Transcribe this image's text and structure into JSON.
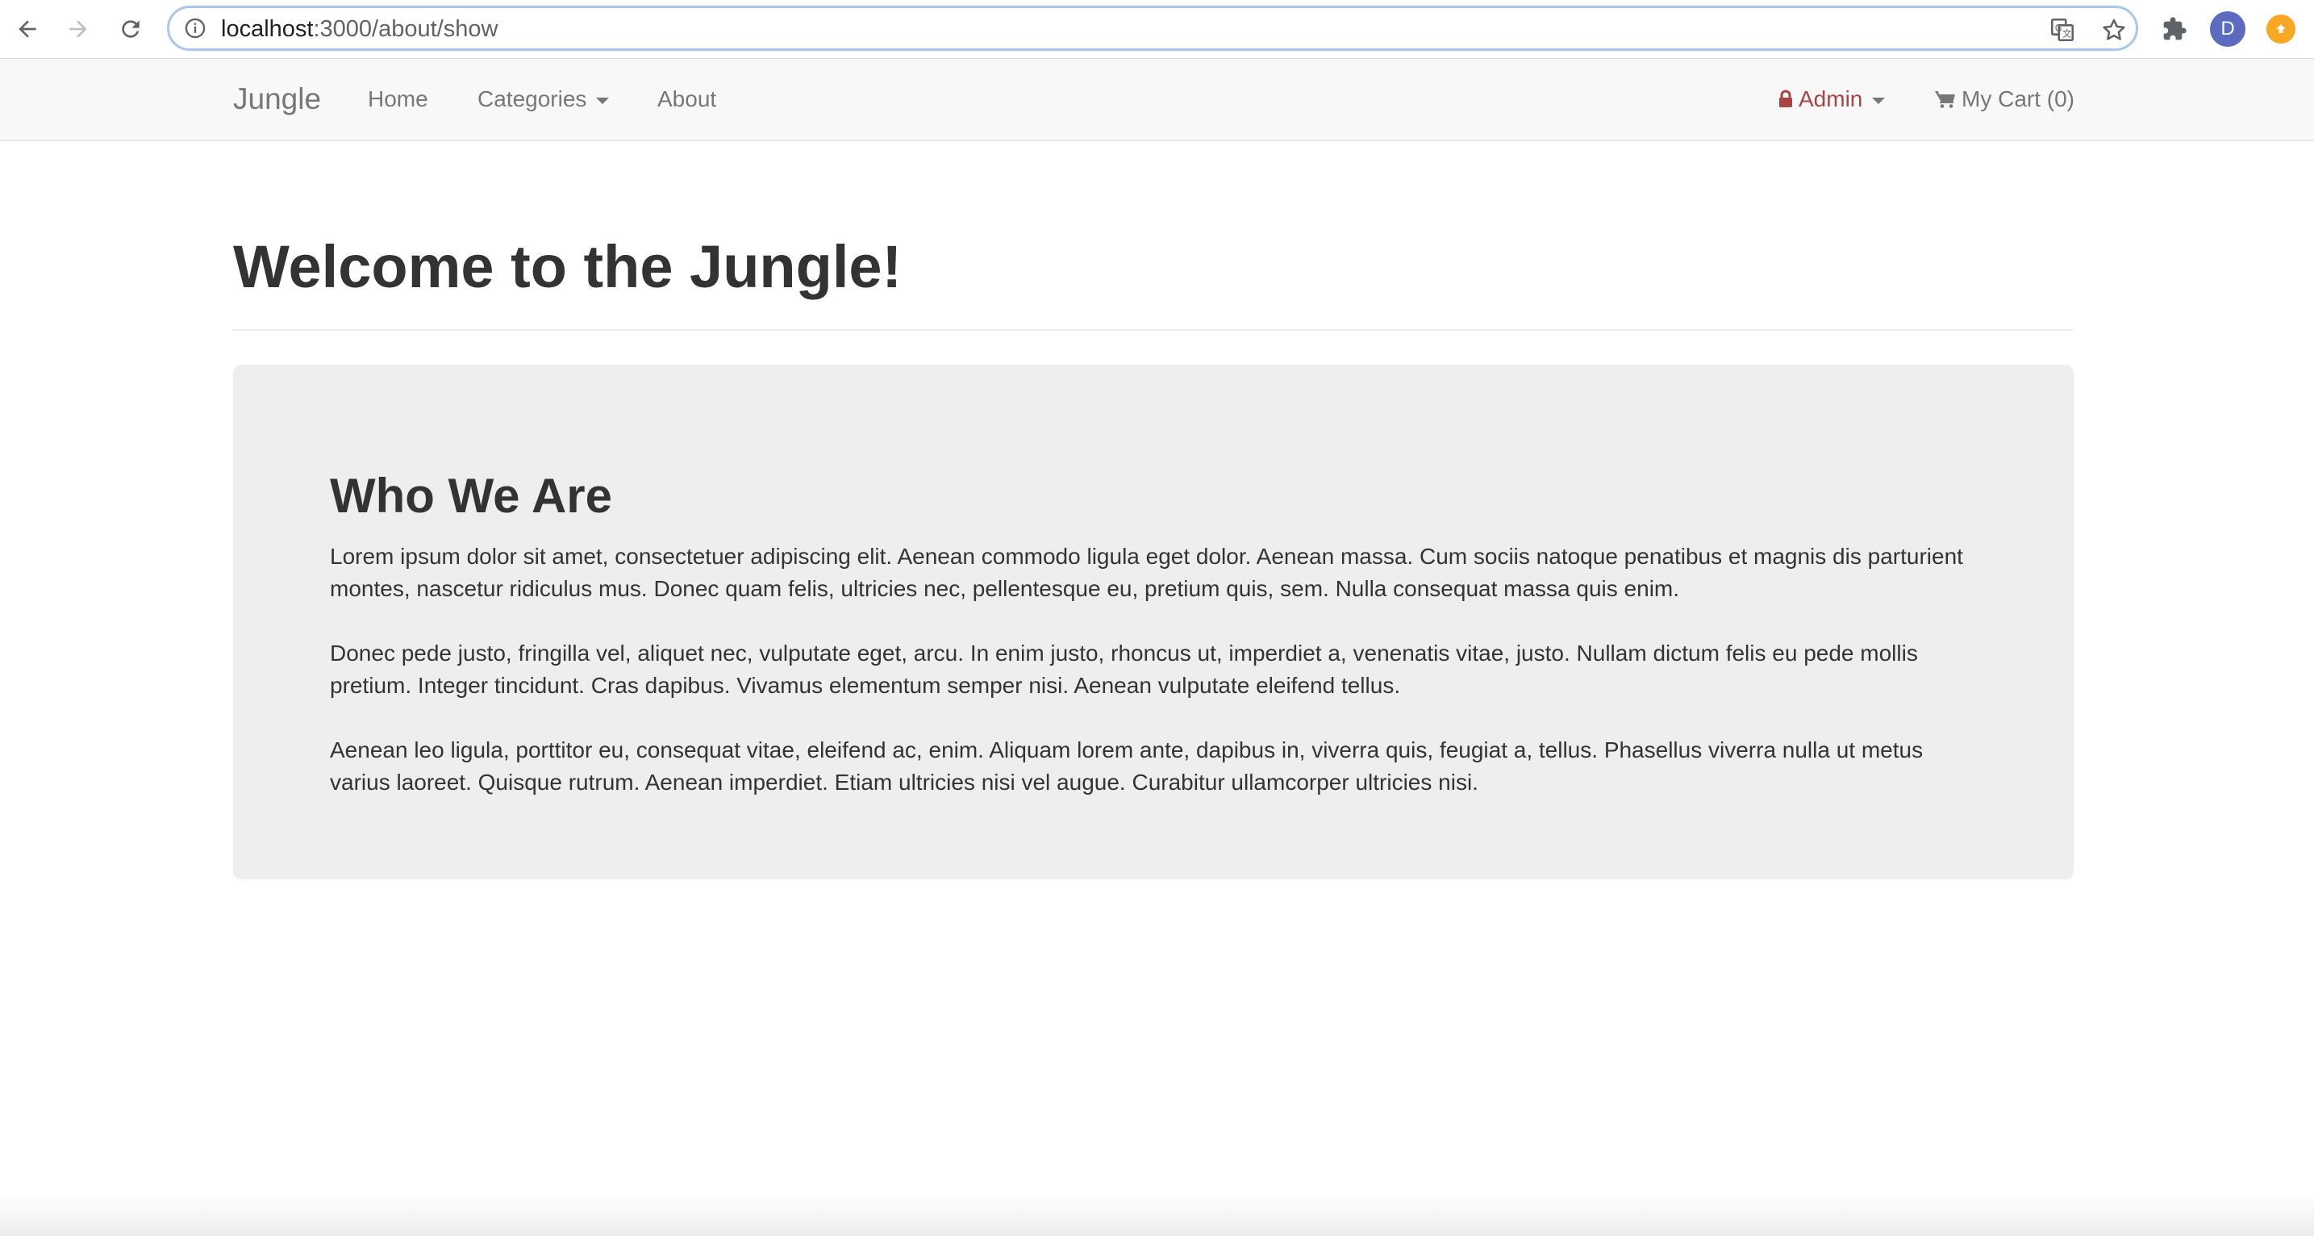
{
  "browser": {
    "url_host": "localhost",
    "url_path": ":3000/about/show",
    "profile_initial": "D"
  },
  "navbar": {
    "brand": "Jungle",
    "home": "Home",
    "categories": "Categories",
    "about": "About",
    "admin": "Admin",
    "cart": "My Cart (0)"
  },
  "page": {
    "title": "Welcome to the Jungle!",
    "section_heading": "Who We Are",
    "paragraphs": [
      "Lorem ipsum dolor sit amet, consectetuer adipiscing elit. Aenean commodo ligula eget dolor. Aenean massa. Cum sociis natoque penatibus et magnis dis parturient montes, nascetur ridiculus mus. Donec quam felis, ultricies nec, pellentesque eu, pretium quis, sem. Nulla consequat massa quis enim.",
      "Donec pede justo, fringilla vel, aliquet nec, vulputate eget, arcu. In enim justo, rhoncus ut, imperdiet a, venenatis vitae, justo. Nullam dictum felis eu pede mollis pretium. Integer tincidunt. Cras dapibus. Vivamus elementum semper nisi. Aenean vulputate eleifend tellus.",
      "Aenean leo ligula, porttitor eu, consequat vitae, eleifend ac, enim. Aliquam lorem ante, dapibus in, viverra quis, feugiat a, tellus. Phasellus viverra nulla ut metus varius laoreet. Quisque rutrum. Aenean imperdiet. Etiam ultricies nisi vel augue. Curabitur ullamcorper ultricies nisi."
    ]
  },
  "colors": {
    "admin_accent": "#a94442",
    "navbar_bg": "#f8f8f8",
    "jumbotron_bg": "#eeeeee",
    "text": "#333333",
    "nav_text": "#777777"
  },
  "icons": [
    "back-arrow-icon",
    "forward-arrow-icon",
    "reload-icon",
    "info-icon",
    "translate-icon",
    "star-icon",
    "puzzle-icon",
    "lock-icon",
    "cart-icon",
    "caret-down-icon"
  ]
}
